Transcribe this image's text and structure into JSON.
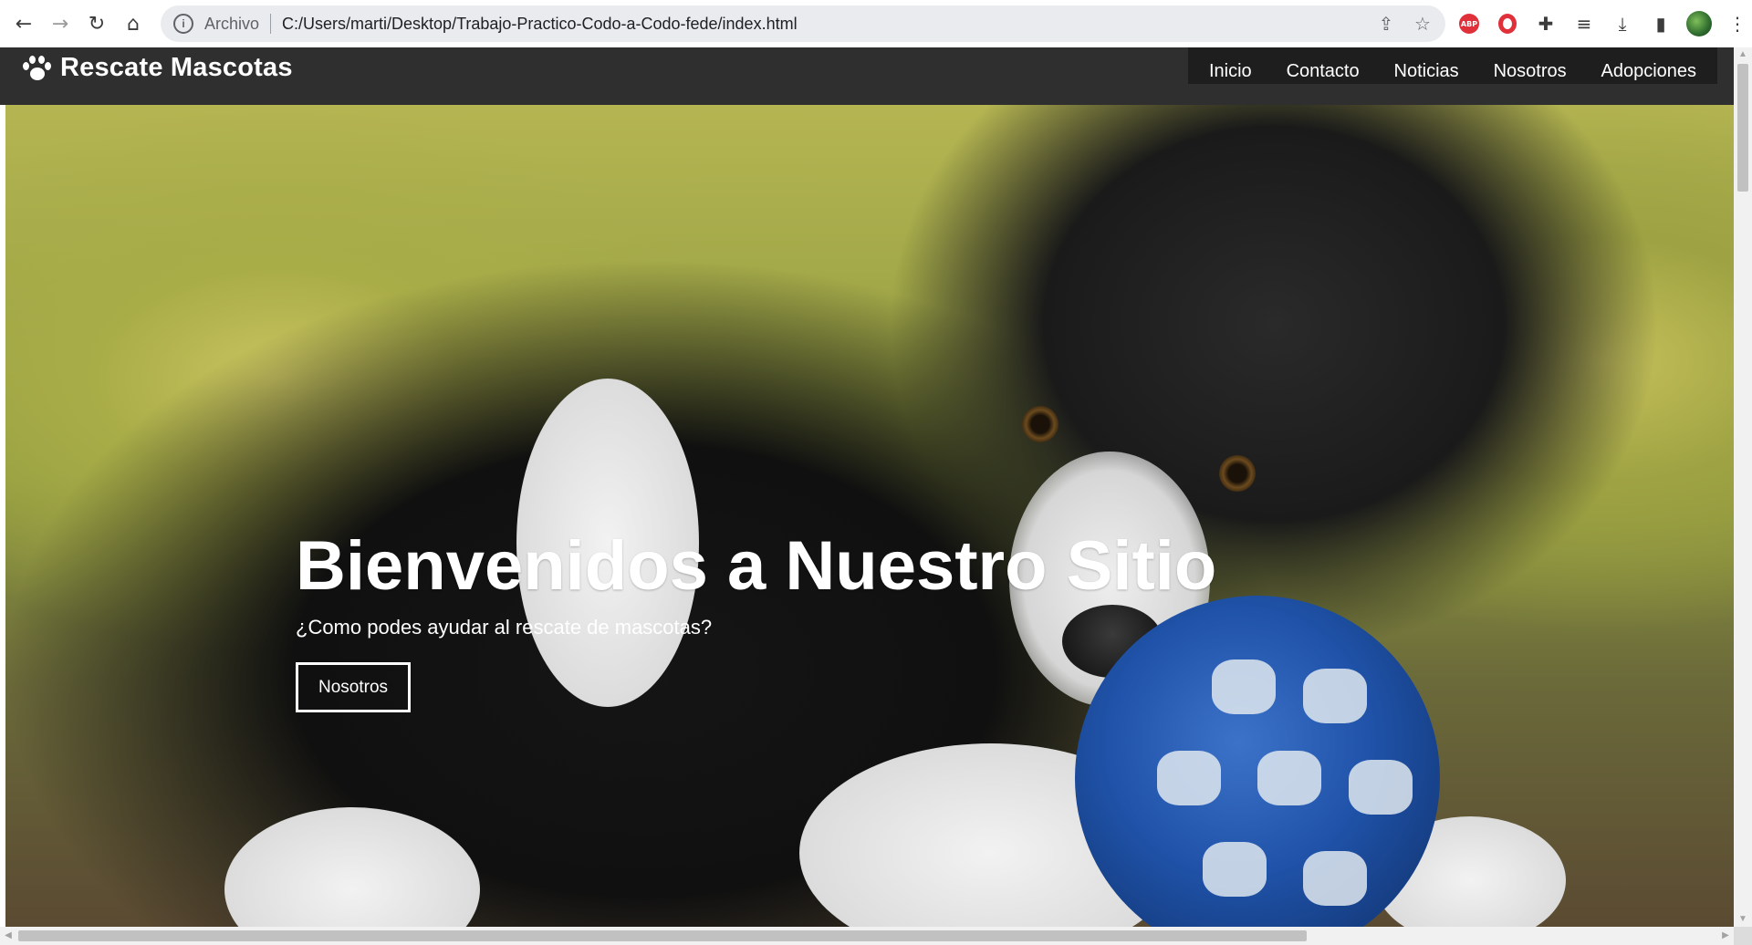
{
  "browser": {
    "back_icon": "←",
    "forward_icon": "→",
    "reload_icon": "↻",
    "home_icon": "⌂",
    "omnibox": {
      "security_label": "Archivo",
      "url": "C:/Users/marti/Desktop/Trabajo-Practico-Codo-a-Codo-fede/index.html"
    },
    "extensions": {
      "adblock_label": "ABP"
    },
    "icons": [
      "info-icon",
      "share-icon",
      "star-icon",
      "adblock-icon",
      "opera-icon",
      "extensions-icon",
      "reading-list-icon",
      "download-icon",
      "side-panel-icon",
      "profile-avatar",
      "menu-icon"
    ]
  },
  "site": {
    "brand": "Rescate Mascotas",
    "nav": [
      {
        "label": "Inicio"
      },
      {
        "label": "Contacto"
      },
      {
        "label": "Noticias"
      },
      {
        "label": "Nosotros"
      },
      {
        "label": "Adopciones"
      }
    ],
    "hero": {
      "title": "Bienvenidos a Nuestro Sitio",
      "subtitle": "¿Como podes ayudar al rescate de mascotas?",
      "button": "Nosotros"
    }
  },
  "colors": {
    "header_bg": "#2f2f2f",
    "menu_bg": "#1e1e1e",
    "text": "#ffffff"
  }
}
